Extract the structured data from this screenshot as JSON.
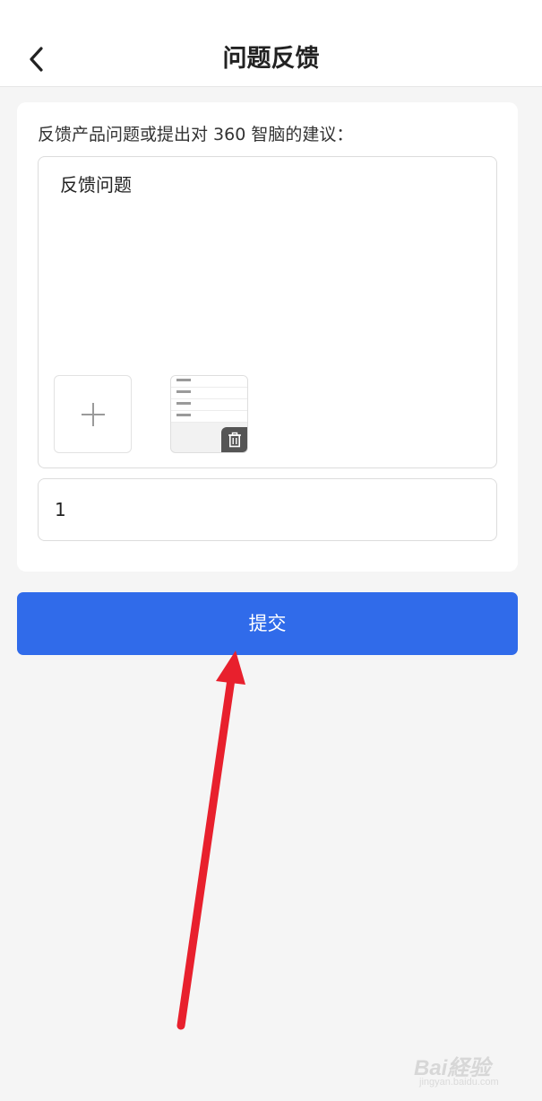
{
  "header": {
    "title": "问题反馈",
    "back_icon": "chevron-left-icon"
  },
  "form": {
    "prompt_label": "反馈产品问题或提出对 360 智脑的建议：",
    "feedback_value": "反馈问题",
    "add_image_icon": "plus-icon",
    "delete_icon": "trash-icon",
    "contact_value": "1"
  },
  "actions": {
    "submit_label": "提交"
  },
  "overlay": {
    "arrow_color": "#e8202d"
  },
  "watermark": {
    "logo_text": "Bai経验",
    "url_text": "jingyan.baidu.com"
  },
  "colors": {
    "primary": "#306bea",
    "background": "#f5f5f5"
  }
}
